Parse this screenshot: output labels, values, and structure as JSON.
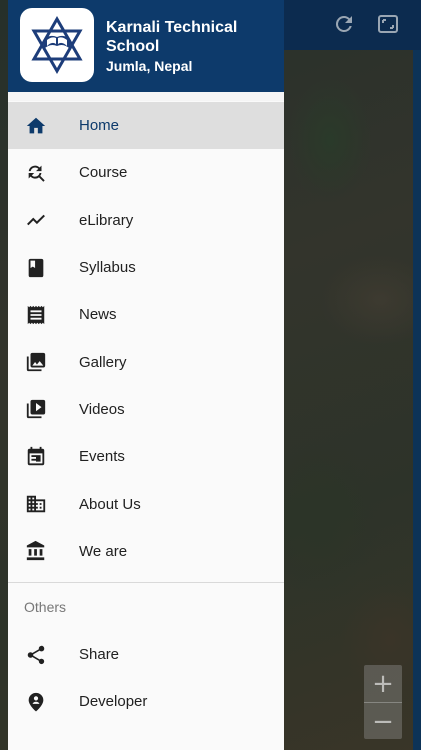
{
  "header": {
    "school_name": "Karnali Technical School",
    "location": "Jumla, Nepal"
  },
  "menu": [
    {
      "label": "Home",
      "icon": "home-icon",
      "active": true
    },
    {
      "label": "Course",
      "icon": "course-search-icon"
    },
    {
      "label": "eLibrary",
      "icon": "trending-icon"
    },
    {
      "label": "Syllabus",
      "icon": "book-icon"
    },
    {
      "label": "News",
      "icon": "news-icon"
    },
    {
      "label": "Gallery",
      "icon": "gallery-icon"
    },
    {
      "label": "Videos",
      "icon": "video-library-icon"
    },
    {
      "label": "Events",
      "icon": "calendar-icon"
    },
    {
      "label": "About Us",
      "icon": "building-icon"
    },
    {
      "label": "We are",
      "icon": "institution-icon"
    }
  ],
  "others": {
    "title": "Others",
    "items": [
      {
        "label": "Share",
        "icon": "share-icon"
      },
      {
        "label": "Developer",
        "icon": "location-person-icon"
      }
    ]
  },
  "map": {
    "zoom_in": "+",
    "zoom_out": "−"
  },
  "colors": {
    "primary": "#0d3a6b",
    "active_bg": "#dedede"
  }
}
